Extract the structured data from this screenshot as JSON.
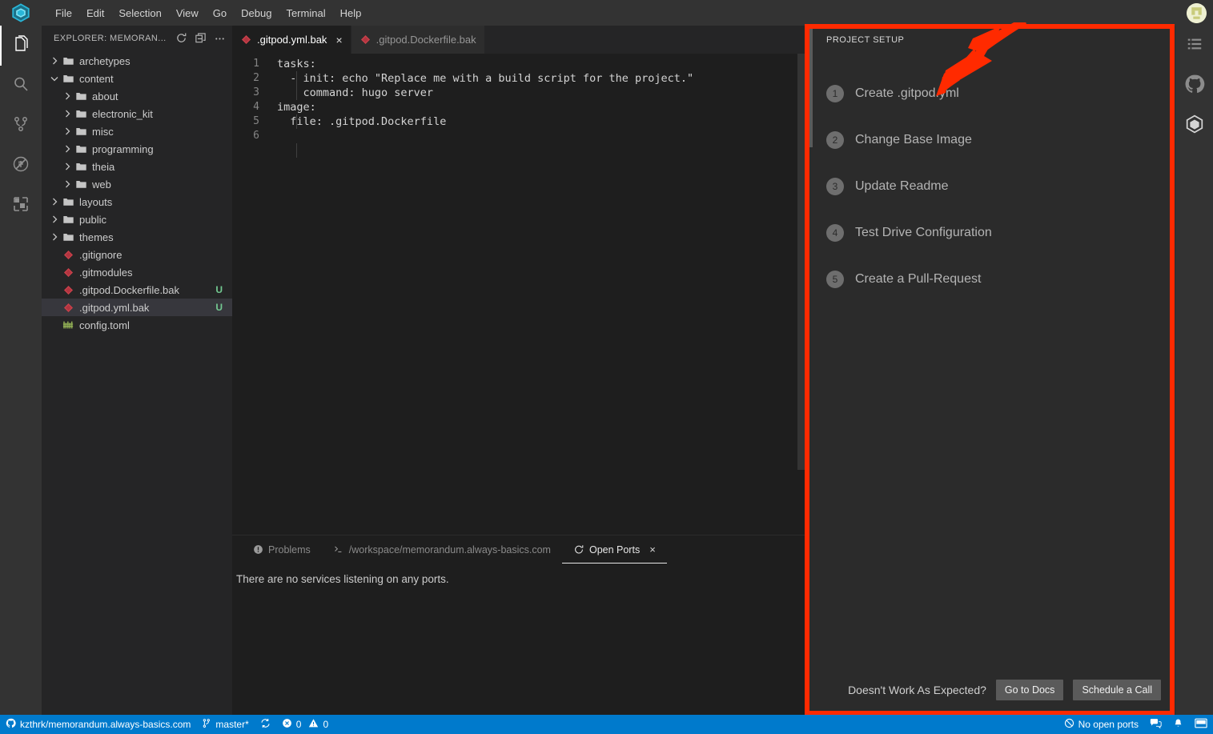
{
  "titlebar": {
    "logo_icon": "gitpod-cube-icon",
    "menus": [
      "File",
      "Edit",
      "Selection",
      "View",
      "Go",
      "Debug",
      "Terminal",
      "Help"
    ],
    "avatar_name": "user-avatar"
  },
  "activitybar": {
    "items": [
      {
        "name": "explorer",
        "icon": "files-icon",
        "active": true
      },
      {
        "name": "search",
        "icon": "search-icon",
        "active": false
      },
      {
        "name": "source-control",
        "icon": "source-control-icon",
        "active": false
      },
      {
        "name": "debug",
        "icon": "debug-icon",
        "active": false
      },
      {
        "name": "extensions",
        "icon": "extensions-icon",
        "active": false
      }
    ]
  },
  "rightbar": {
    "items": [
      {
        "name": "outline",
        "icon": "list-icon"
      },
      {
        "name": "github",
        "icon": "github-icon"
      },
      {
        "name": "gitpod",
        "icon": "gitpod-cube-icon"
      }
    ]
  },
  "sidebar": {
    "title": "EXPLORER: MEMORAN...",
    "actions": [
      {
        "name": "refresh",
        "icon": "refresh-icon"
      },
      {
        "name": "collapse-all",
        "icon": "collapse-all-icon"
      },
      {
        "name": "more-actions",
        "icon": "ellipsis-icon"
      }
    ],
    "tree": [
      {
        "label": "archetypes",
        "type": "folder",
        "depth": 0,
        "expanded": false,
        "selected": false,
        "git": ""
      },
      {
        "label": "content",
        "type": "folder",
        "depth": 0,
        "expanded": true,
        "selected": false,
        "git": ""
      },
      {
        "label": "about",
        "type": "folder",
        "depth": 1,
        "expanded": false,
        "selected": false,
        "git": ""
      },
      {
        "label": "electronic_kit",
        "type": "folder",
        "depth": 1,
        "expanded": false,
        "selected": false,
        "git": ""
      },
      {
        "label": "misc",
        "type": "folder",
        "depth": 1,
        "expanded": false,
        "selected": false,
        "git": ""
      },
      {
        "label": "programming",
        "type": "folder",
        "depth": 1,
        "expanded": false,
        "selected": false,
        "git": ""
      },
      {
        "label": "theia",
        "type": "folder",
        "depth": 1,
        "expanded": false,
        "selected": false,
        "git": ""
      },
      {
        "label": "web",
        "type": "folder",
        "depth": 1,
        "expanded": false,
        "selected": false,
        "git": ""
      },
      {
        "label": "layouts",
        "type": "folder",
        "depth": 0,
        "expanded": false,
        "selected": false,
        "git": ""
      },
      {
        "label": "public",
        "type": "folder",
        "depth": 0,
        "expanded": false,
        "selected": false,
        "git": ""
      },
      {
        "label": "themes",
        "type": "folder",
        "depth": 0,
        "expanded": false,
        "selected": false,
        "git": ""
      },
      {
        "label": ".gitignore",
        "type": "git-file",
        "depth": 0,
        "expanded": false,
        "selected": false,
        "git": ""
      },
      {
        "label": ".gitmodules",
        "type": "git-file",
        "depth": 0,
        "expanded": false,
        "selected": false,
        "git": ""
      },
      {
        "label": ".gitpod.Dockerfile.bak",
        "type": "git-file",
        "depth": 0,
        "expanded": false,
        "selected": false,
        "git": "U"
      },
      {
        "label": ".gitpod.yml.bak",
        "type": "git-file",
        "depth": 0,
        "expanded": false,
        "selected": true,
        "git": "U"
      },
      {
        "label": "config.toml",
        "type": "toml-file",
        "depth": 0,
        "expanded": false,
        "selected": false,
        "git": ""
      }
    ]
  },
  "editor": {
    "tabs": [
      {
        "label": ".gitpod.yml.bak",
        "active": true,
        "icon": "yaml-file-icon",
        "closeable": true
      },
      {
        "label": ".gitpod.Dockerfile.bak",
        "active": false,
        "icon": "docker-file-icon",
        "closeable": false
      }
    ],
    "lines": [
      {
        "num": "1",
        "text": "tasks:"
      },
      {
        "num": "2",
        "text": "  - init: echo \"Replace me with a build script for the project.\""
      },
      {
        "num": "3",
        "text": "    command: hugo server"
      },
      {
        "num": "4",
        "text": "image:"
      },
      {
        "num": "5",
        "text": "  file: .gitpod.Dockerfile"
      },
      {
        "num": "6",
        "text": ""
      }
    ]
  },
  "panel": {
    "tabs": [
      {
        "label": "Problems",
        "icon": "problems-icon",
        "active": false,
        "closeable": false
      },
      {
        "label": "/workspace/memorandum.always-basics.com",
        "icon": "terminal-icon",
        "active": false,
        "closeable": false
      },
      {
        "label": "Open Ports",
        "icon": "ports-refresh-icon",
        "active": true,
        "closeable": true
      }
    ],
    "body_text": "There are no services listening on any ports."
  },
  "setup": {
    "title": "PROJECT SETUP",
    "steps": [
      {
        "num": "1",
        "label": "Create .gitpod.yml"
      },
      {
        "num": "2",
        "label": "Change Base Image"
      },
      {
        "num": "3",
        "label": "Update Readme"
      },
      {
        "num": "4",
        "label": "Test Drive Configuration"
      },
      {
        "num": "5",
        "label": "Create a Pull-Request"
      }
    ],
    "footer_question": "Doesn't Work As Expected?",
    "docs_button": "Go to Docs",
    "call_button": "Schedule a Call"
  },
  "annotation": {
    "highlight_color": "#ff2a00",
    "arrow_target": "Create .gitpod.yml"
  },
  "statusbar": {
    "left": [
      {
        "name": "remote-repo",
        "icon": "github-icon",
        "label": "kzthrk/memorandum.always-basics.com"
      },
      {
        "name": "branch",
        "icon": "branch-icon",
        "label": "master*"
      },
      {
        "name": "sync",
        "icon": "sync-icon",
        "label": ""
      },
      {
        "name": "errors-warnings",
        "icon": "error-warning-icon",
        "label": "0",
        "label2": "0"
      }
    ],
    "right": [
      {
        "name": "open-ports",
        "icon": "no-ports-icon",
        "label": "No open ports"
      },
      {
        "name": "feedback",
        "icon": "comment-icon",
        "label": ""
      },
      {
        "name": "notifications",
        "icon": "bell-icon",
        "label": ""
      },
      {
        "name": "layout",
        "icon": "layout-icon",
        "label": ""
      }
    ]
  }
}
